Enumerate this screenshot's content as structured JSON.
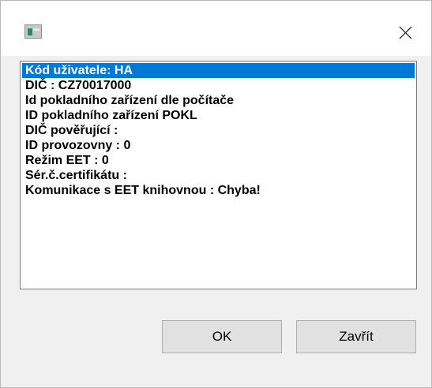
{
  "window": {
    "app_icon": "application-icon",
    "close_icon": "close-icon"
  },
  "list": {
    "items": [
      "Kód uživatele: HA",
      "DIČ : CZ70017000",
      "Id pokladního zařízení dle počítače",
      "ID pokladního zařízení POKL",
      "DIČ pověřující :",
      "ID provozovny : 0",
      "Režim EET : 0",
      "Sér.č.certifikátu :",
      "Komunikace s EET knihovnou : Chyba!"
    ],
    "selected_index": 0
  },
  "buttons": {
    "ok_label": "OK",
    "close_label": "Zavřít"
  },
  "colors": {
    "selection": "#0078d7",
    "button_face": "#e1e1e1",
    "dialog_background": "#f0f0f0"
  }
}
